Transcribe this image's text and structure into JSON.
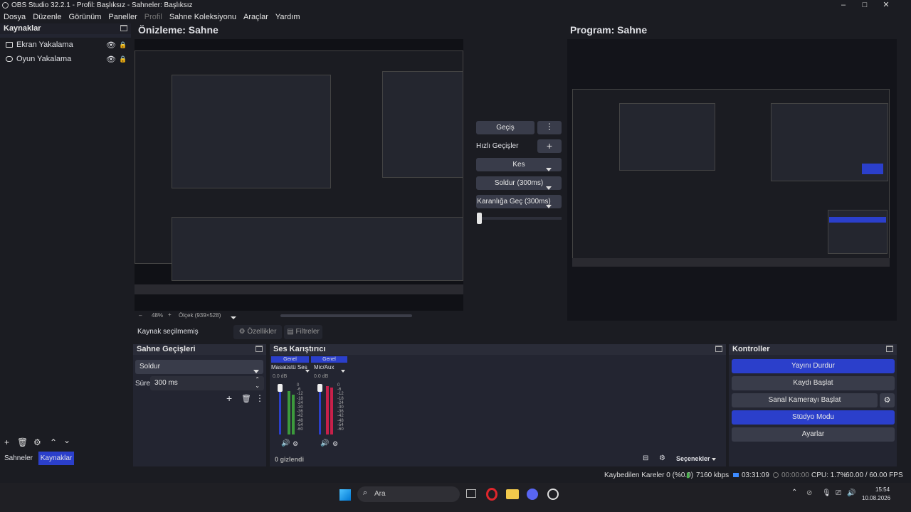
{
  "window": {
    "title": "OBS Studio 32.2.1 - Profil: Başlıksız - Sahneler: Başlıksız"
  },
  "menu": [
    {
      "label": "Dosya"
    },
    {
      "label": "Düzenle"
    },
    {
      "label": "Görünüm"
    },
    {
      "label": "Paneller"
    },
    {
      "label": "Profil",
      "disabled": true
    },
    {
      "label": "Sahne Koleksiyonu"
    },
    {
      "label": "Araçlar"
    },
    {
      "label": "Yardım"
    }
  ],
  "sources_panel": {
    "title": "Kaynaklar",
    "items": [
      {
        "label": "Ekran Yakalama"
      },
      {
        "label": "Oyun Yakalama"
      }
    ]
  },
  "bottom_tabs": {
    "scenes": "Sahneler",
    "sources": "Kaynaklar"
  },
  "preview": {
    "title": "Önizleme: Sahne",
    "zoom": "48%",
    "canvas": "Ölçek (939×528)"
  },
  "program": {
    "title": "Program: Sahne"
  },
  "transitions": {
    "gecis": "Geçiş",
    "quick": "Hızlı Geçişler",
    "items": [
      {
        "label": "Kes"
      },
      {
        "label": "Soldur (300ms)"
      },
      {
        "label": "Karanlığa Geç (300ms)"
      }
    ]
  },
  "source_bar": {
    "status": "Kaynak seçilmemiş",
    "properties": "Özellikler",
    "filters": "Filtreler"
  },
  "scene_transitions": {
    "title": "Sahne Geçişleri",
    "selected": "Soldur",
    "duration_label": "Süre",
    "duration_value": "300 ms"
  },
  "audio_mixer": {
    "title": "Ses Karıştırıcı",
    "channels": [
      {
        "group": "Genel",
        "name": "Masaüstü Ses",
        "db": "0.0 dB",
        "level": 0.85
      },
      {
        "group": "Genel",
        "name": "Mic/Aux",
        "db": "0.0 dB",
        "level": 0.95
      }
    ],
    "scale": [
      "0",
      "-6",
      "-12",
      "-18",
      "-24",
      "-30",
      "-36",
      "-42",
      "-48",
      "-54",
      "-60"
    ],
    "hidden": "0 gizlendi",
    "options": "Seçenekler"
  },
  "controls": {
    "title": "Kontroller",
    "stop_stream": "Yayını Durdur",
    "start_record": "Kaydı Başlat",
    "virtual_cam": "Sanal Kamerayı Başlat",
    "studio_mode": "Stüdyo Modu",
    "settings": "Ayarlar"
  },
  "status": {
    "dropped": "Kaybedilen Kareler 0 (%0.0)",
    "bitrate": "7160 kbps",
    "stream_time": "03:31:09",
    "record_time": "00:00:00",
    "cpu": "CPU: 1.7%",
    "fps": "60.00 / 60.00 FPS"
  },
  "taskbar": {
    "search": "Ara",
    "time": "15:54",
    "date": "10.08.2026"
  },
  "colors": {
    "accent": "#2b3fcb",
    "panel": "#232531",
    "bg": "#1b1c22",
    "meter_green": "#3c9a3c",
    "meter_red": "#c8204a"
  }
}
